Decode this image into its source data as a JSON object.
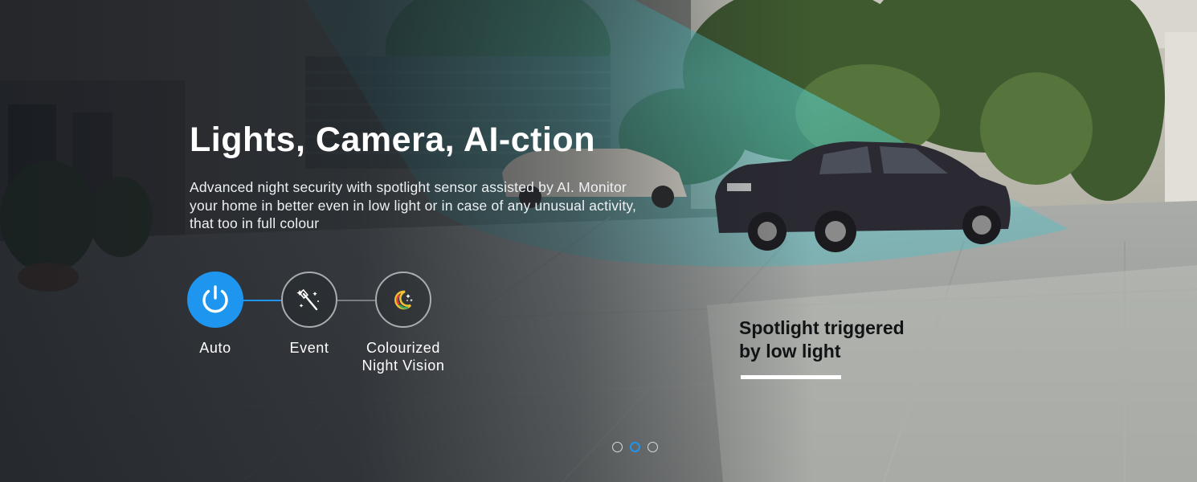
{
  "hero": {
    "title": "Lights, Camera, AI-ction",
    "description": "Advanced night security with spotlight sensor assisted by AI. Monitor your home in better even in low light or in case of any unusual activity, that too in full colour"
  },
  "modes": [
    {
      "label": "Auto",
      "icon": "power-icon",
      "active": true
    },
    {
      "label": "Event",
      "icon": "magic-wand-icon",
      "active": false
    },
    {
      "label": "Colourized\nNight Vision",
      "icon": "colour-moon-icon",
      "active": false
    }
  ],
  "callout": {
    "line1": "Spotlight triggered",
    "line2": "by low light"
  },
  "carousel": {
    "slides": 3,
    "active_index": 1
  },
  "colors": {
    "accent": "#1e95ee",
    "spotlight": "#4fd6d6",
    "text_light": "#ffffff",
    "text_dark": "#111315"
  }
}
